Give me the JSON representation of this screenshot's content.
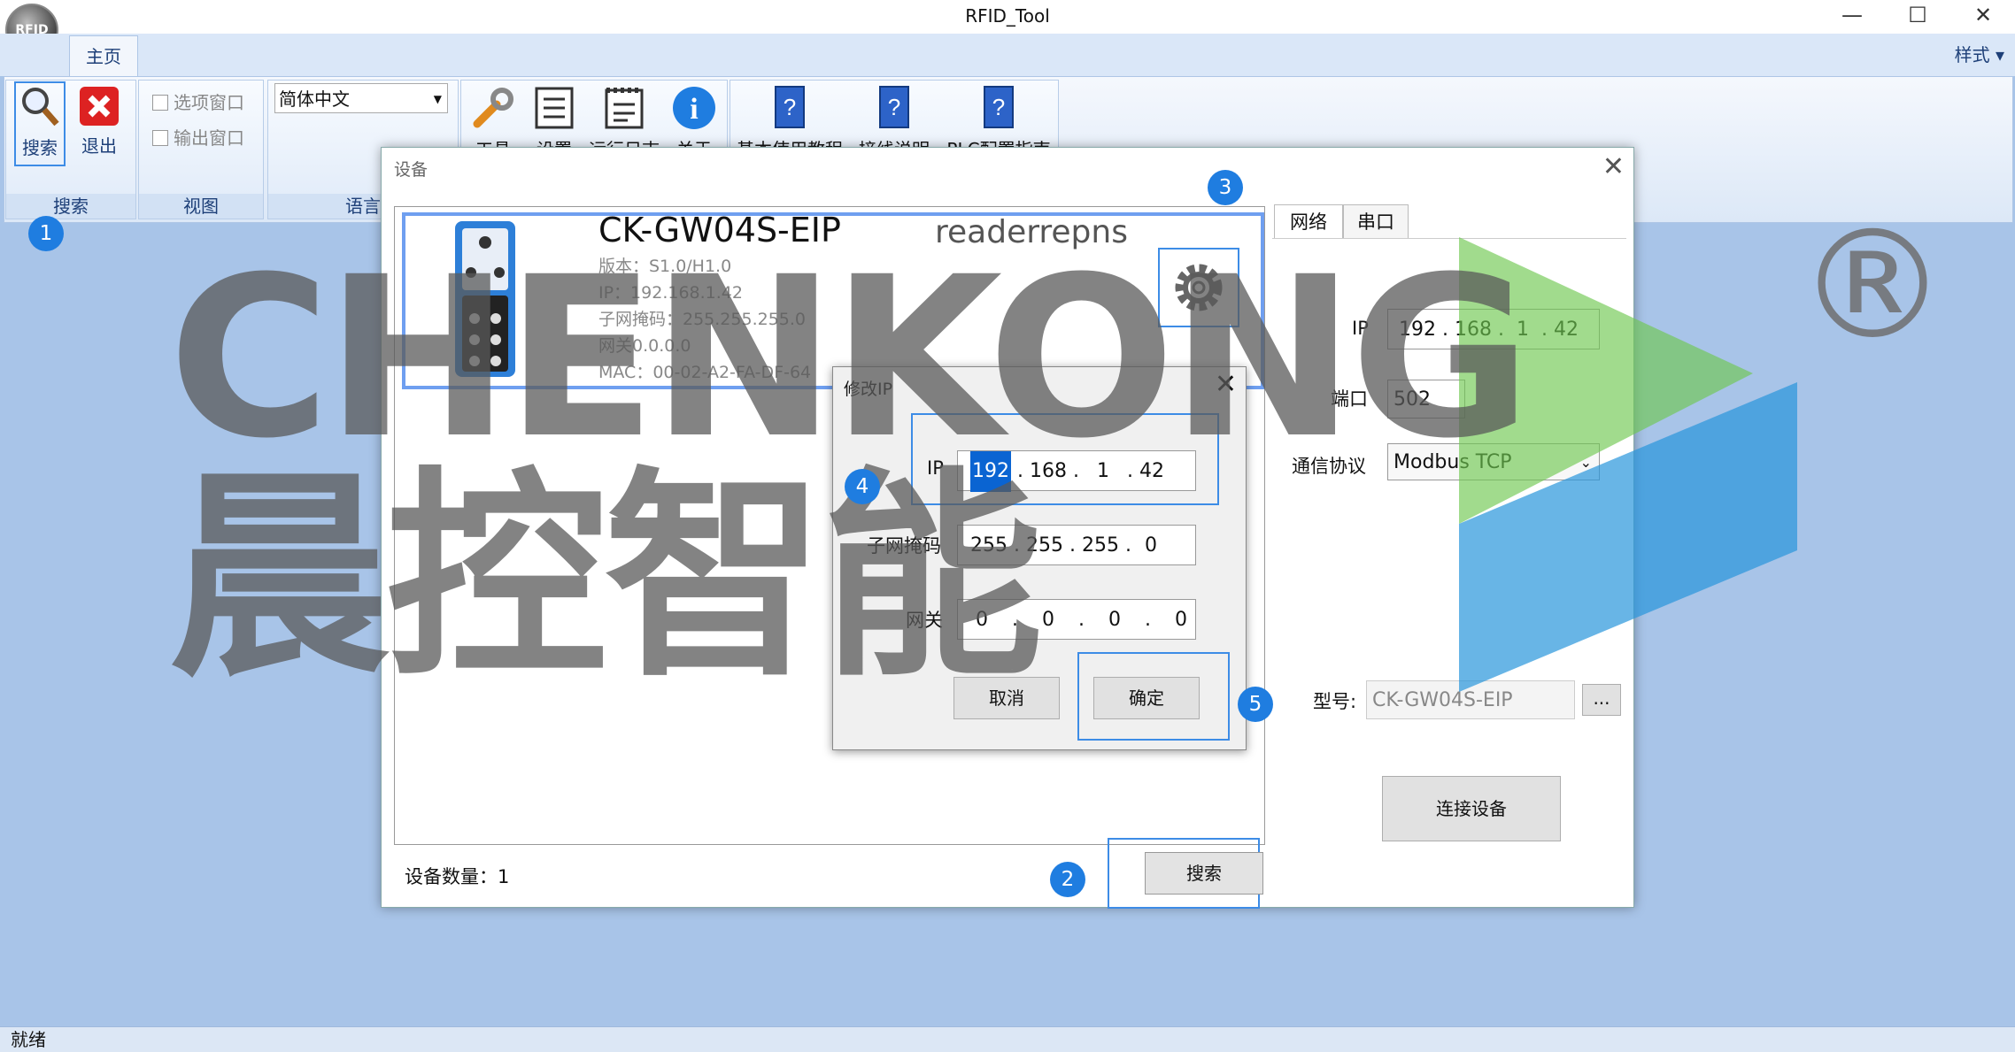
{
  "window": {
    "title": "RFID_Tool",
    "logo_text": "RFID",
    "minimize": "—",
    "maximize": "☐",
    "close": "✕"
  },
  "ribbon": {
    "tabs": [
      {
        "label": "主页"
      }
    ],
    "style_menu": "样式",
    "groups": {
      "search": "搜索",
      "view": "视图",
      "language": "语言"
    },
    "buttons": {
      "search": "搜索",
      "exit": "退出",
      "tools": "工具",
      "settings": "设置",
      "runlog": "运行日志",
      "about": "关于",
      "help1": "基本使用教程",
      "help2": "接线说明",
      "help3": "PLC配置指南"
    },
    "checkboxes": {
      "options_window": "选项窗口",
      "output_window": "输出窗口"
    },
    "language_select": "简体中文"
  },
  "device_dialog": {
    "title": "设备",
    "device": {
      "model": "CK-GW04S-EIP",
      "name": "readerrepns",
      "version": "版本：S1.0/H1.0",
      "ip": "IP：192.168.1.42",
      "subnet": "子网掩码：255.255.255.0",
      "gateway": "网关0.0.0.0",
      "mac": "MAC：00-02-A2-FA-DF-64"
    },
    "device_count_label": "设备数量：1",
    "search_button": "搜索",
    "tabs": [
      {
        "label": "网络"
      },
      {
        "label": "串口"
      }
    ],
    "network": {
      "ip_label": "IP",
      "ip": [
        "192",
        "168",
        "1",
        "42"
      ],
      "port_label": "端口",
      "port": "502",
      "protocol_label": "通信协议",
      "protocol": "Modbus TCP",
      "model_label": "型号:",
      "model": "CK-GW04S-EIP",
      "browse": "...",
      "connect_button": "连接设备"
    }
  },
  "modify_ip_dialog": {
    "title": "修改IP",
    "ip_label": "IP",
    "ip": [
      "192",
      "168",
      "1",
      "42"
    ],
    "subnet_label": "子网掩码",
    "subnet": [
      "255",
      "255",
      "255",
      "0"
    ],
    "gateway_label": "网关",
    "gateway": [
      "0",
      "0",
      "0",
      "0"
    ],
    "cancel": "取消",
    "ok": "确定"
  },
  "badges": [
    "1",
    "2",
    "3",
    "4",
    "5"
  ],
  "watermark": {
    "text": "CHENKONG",
    "chinese": "晨控智能",
    "registered": "®"
  },
  "statusbar": {
    "text": "就绪"
  },
  "colors": {
    "highlight": "#3d8ce6",
    "badge": "#1f7de0",
    "background": "#a8c4e8"
  }
}
